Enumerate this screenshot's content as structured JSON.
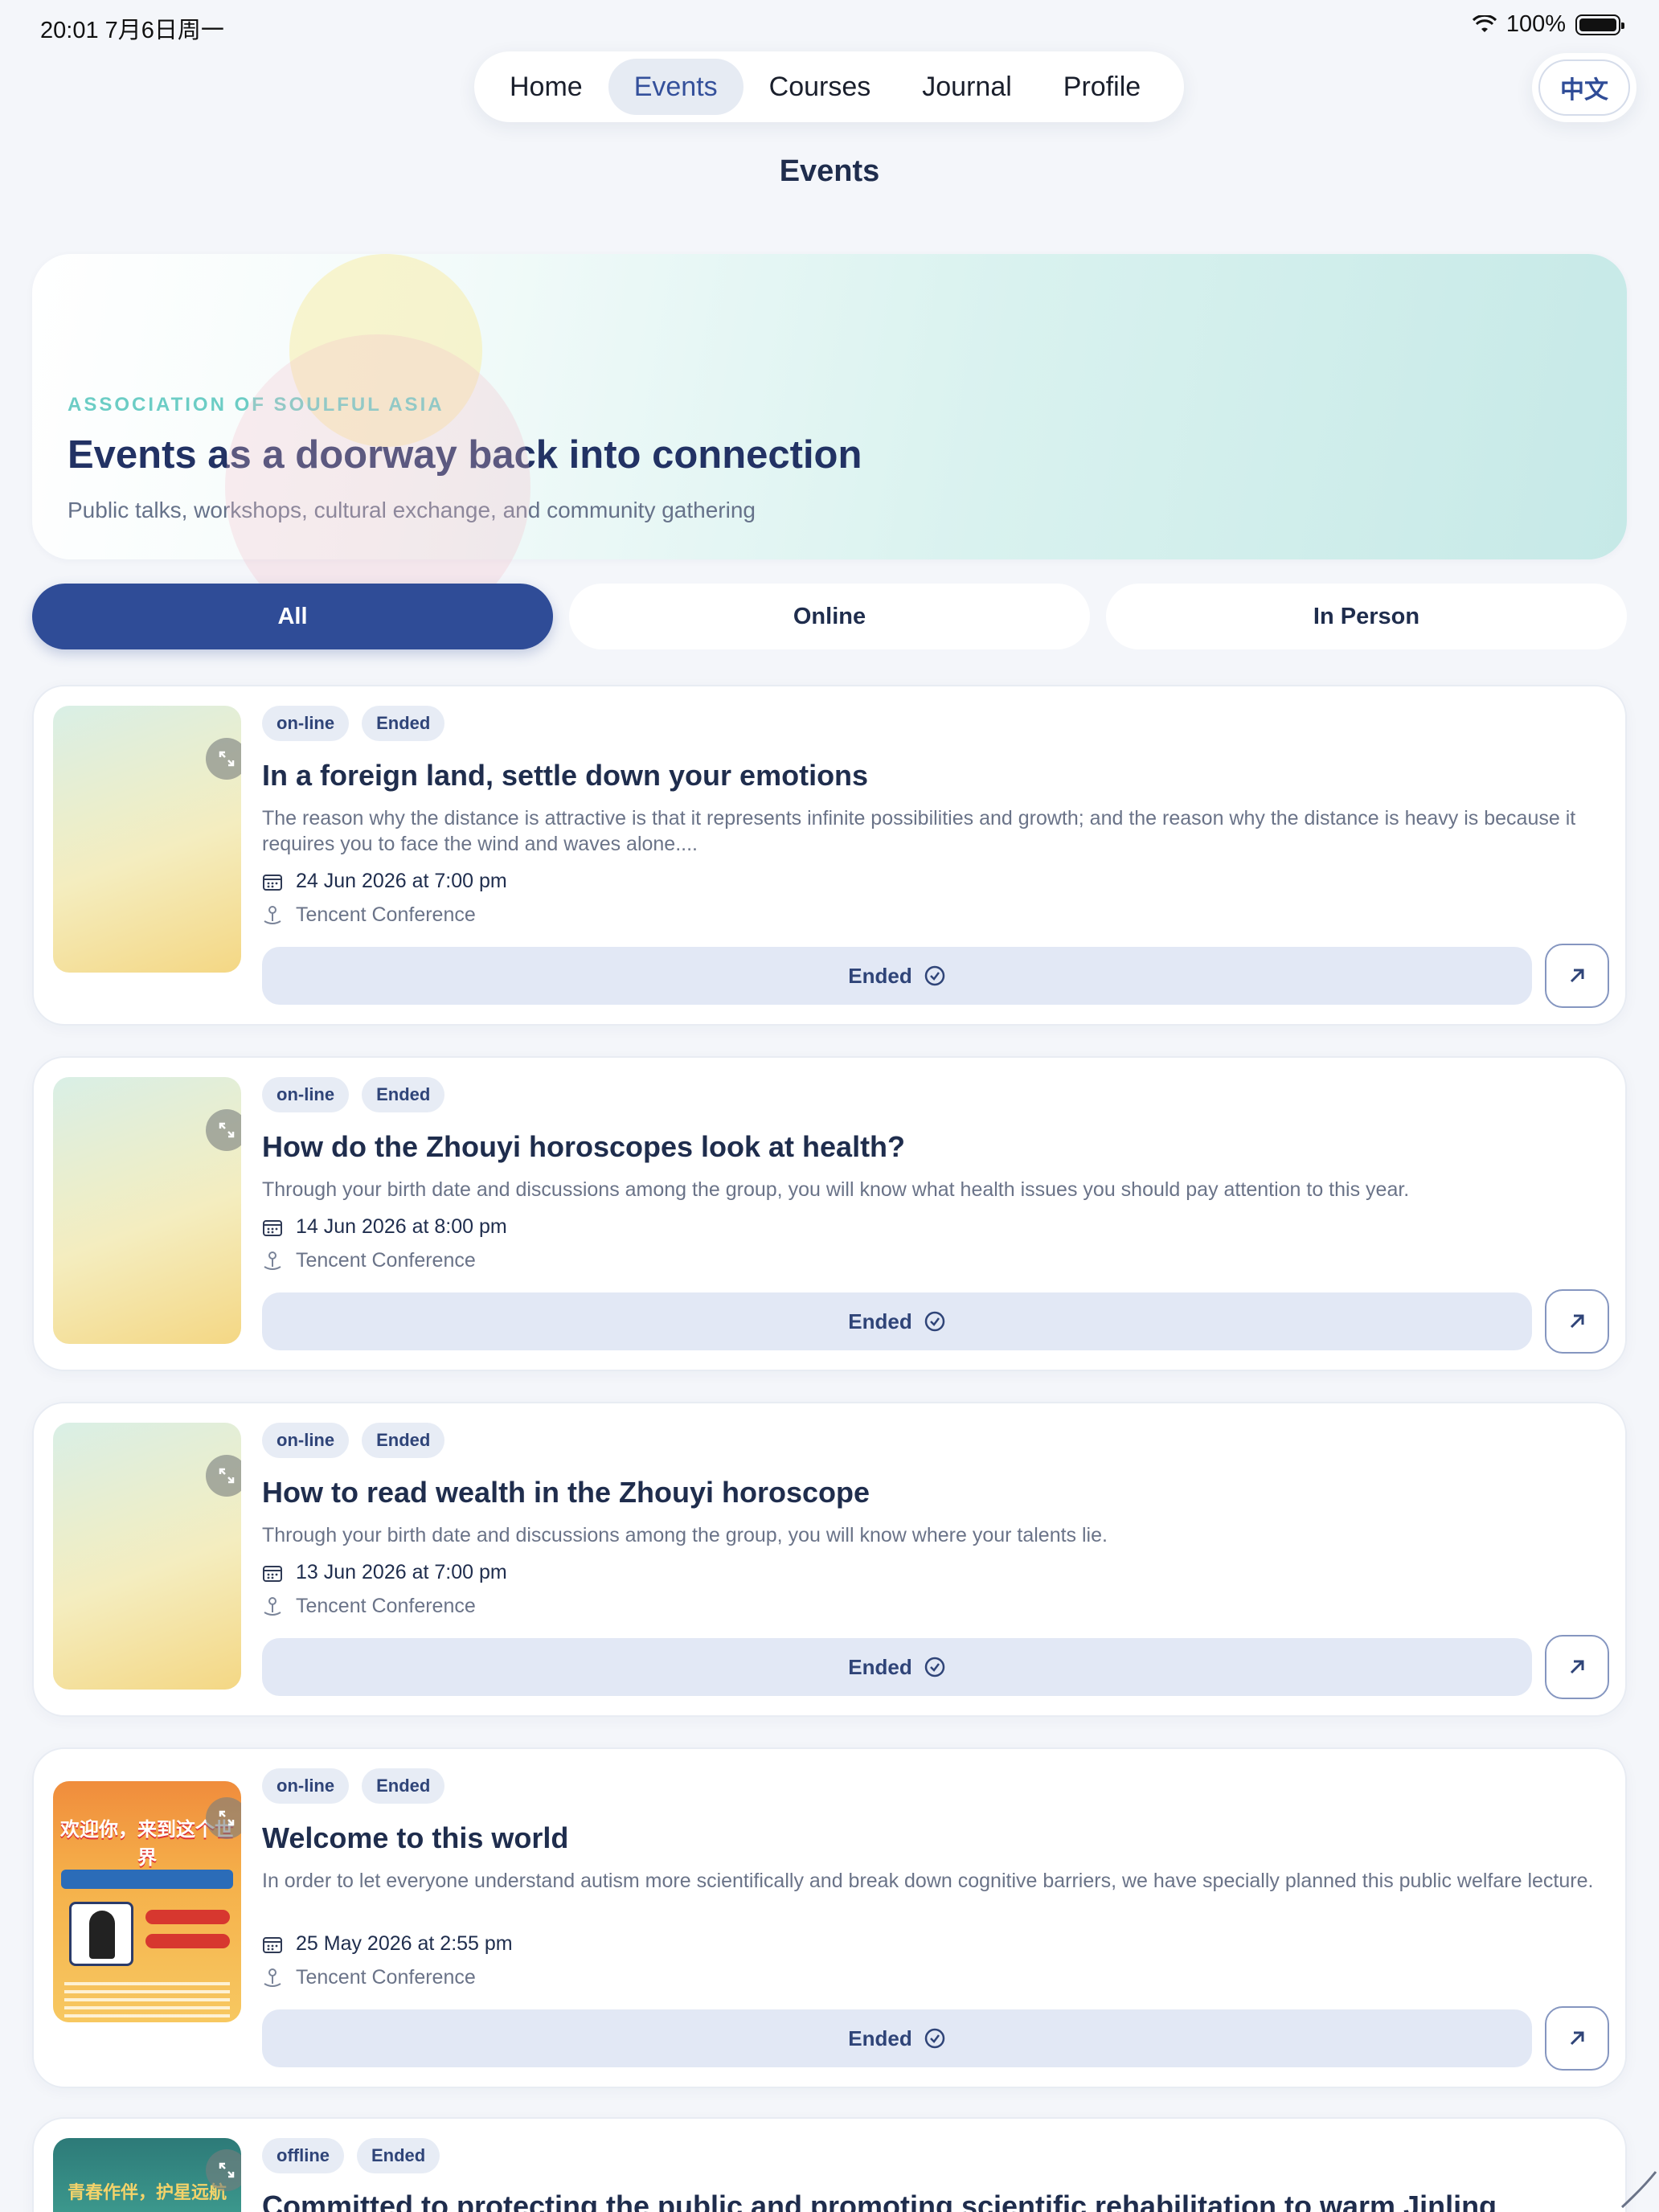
{
  "status": {
    "time": "20:01  7月6日周一",
    "battery": "100%"
  },
  "nav": {
    "items": [
      "Home",
      "Events",
      "Courses",
      "Journal",
      "Profile"
    ],
    "active": "Events",
    "lang": "中文"
  },
  "page": {
    "title": "Events"
  },
  "hero": {
    "eyebrow": "ASSOCIATION OF SOULFUL ASIA",
    "title": "Events as a doorway back into connection",
    "subtitle": "Public talks, workshops, cultural exchange, and community gathering"
  },
  "filters": {
    "all": "All",
    "online": "Online",
    "in_person": "In Person"
  },
  "events": [
    {
      "tags": [
        "on-line",
        "Ended"
      ],
      "title": "In a foreign land, settle down your emotions",
      "desc": "The reason why the distance is attractive is that it represents infinite possibilities and growth; and the reason why the distance is heavy is because it requires you to face the wind and waves alone....",
      "date": "24 Jun 2026 at 7:00 pm",
      "place": "Tencent Conference",
      "status": "Ended"
    },
    {
      "tags": [
        "on-line",
        "Ended"
      ],
      "title": "How do the Zhouyi horoscopes look at health?",
      "desc": "Through your birth date and discussions among the group, you will know what health issues you should pay attention to this year.",
      "date": "14 Jun 2026 at 8:00 pm",
      "place": "Tencent Conference",
      "status": "Ended"
    },
    {
      "tags": [
        "on-line",
        "Ended"
      ],
      "title": "How to read wealth in the Zhouyi horoscope",
      "desc": "Through your birth date and discussions among the group, you will know where your talents lie.",
      "date": "13 Jun 2026 at 7:00 pm",
      "place": "Tencent Conference",
      "status": "Ended"
    },
    {
      "tags": [
        "on-line",
        "Ended"
      ],
      "title": "Welcome to this world",
      "desc": "In order to let everyone understand autism more scientifically and break down cognitive barriers, we have specially planned this public welfare lecture.",
      "date": "25 May 2026 at 2:55 pm",
      "place": "Tencent Conference",
      "status": "Ended",
      "poster_text": "欢迎你，来到这个世界"
    },
    {
      "tags": [
        "offline",
        "Ended"
      ],
      "title": "Committed to protecting the public and promoting scientific rehabilitation to warm Jinling",
      "poster_text": "青春作伴，护星远航"
    }
  ],
  "colors": {
    "primary": "#2f4c97",
    "teal": "#6ccdc5",
    "tag_bg": "#e7ecf5"
  }
}
